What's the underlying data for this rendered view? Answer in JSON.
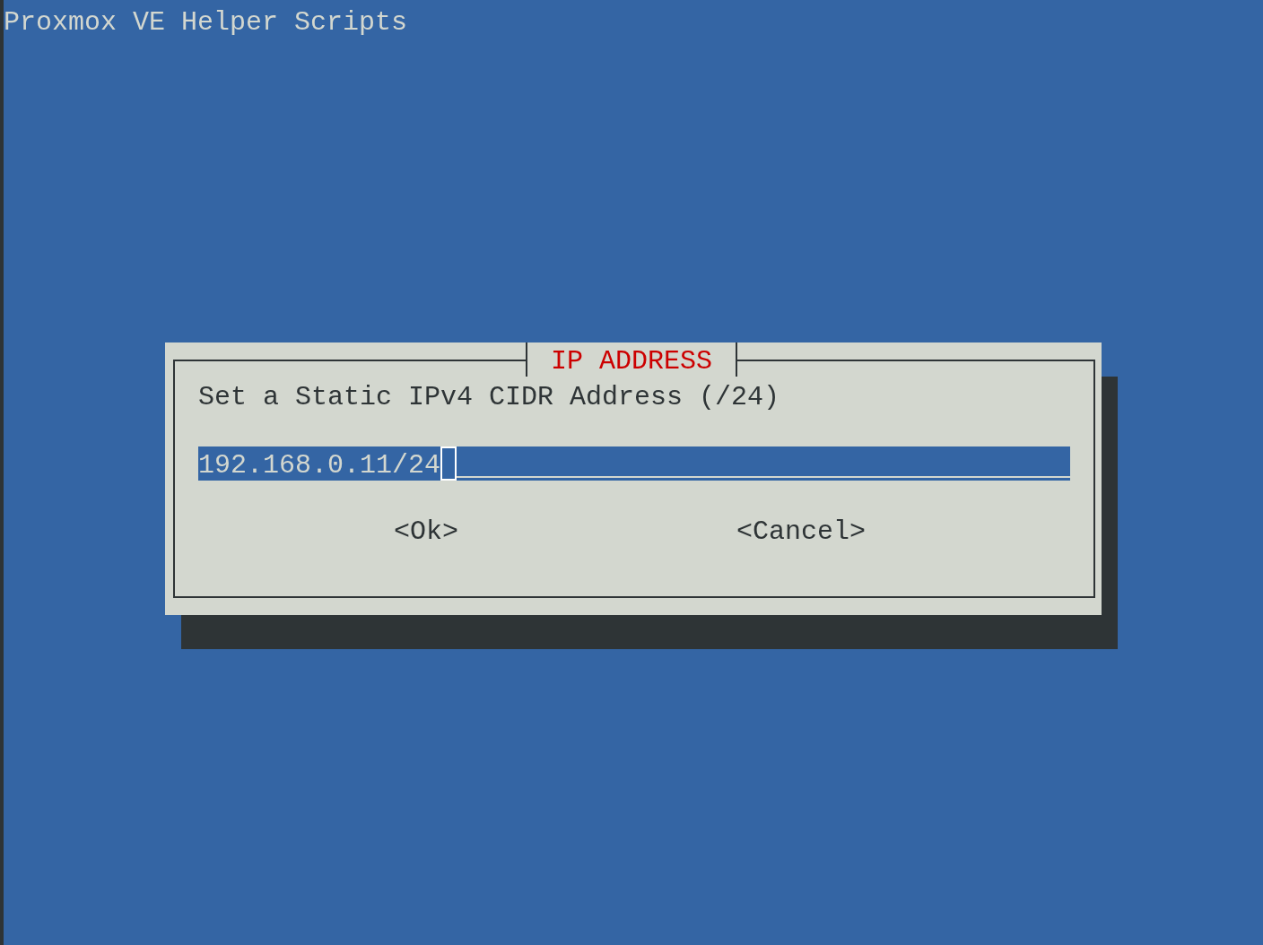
{
  "screen": {
    "title": "Proxmox VE Helper Scripts"
  },
  "dialog": {
    "title": "IP ADDRESS",
    "prompt": "Set a Static IPv4 CIDR Address (/24)",
    "input": {
      "value": "192.168.0.11/24"
    },
    "buttons": [
      {
        "label": "<Ok>",
        "selected": false
      },
      {
        "label": "<Cancel>",
        "selected": false
      }
    ]
  }
}
